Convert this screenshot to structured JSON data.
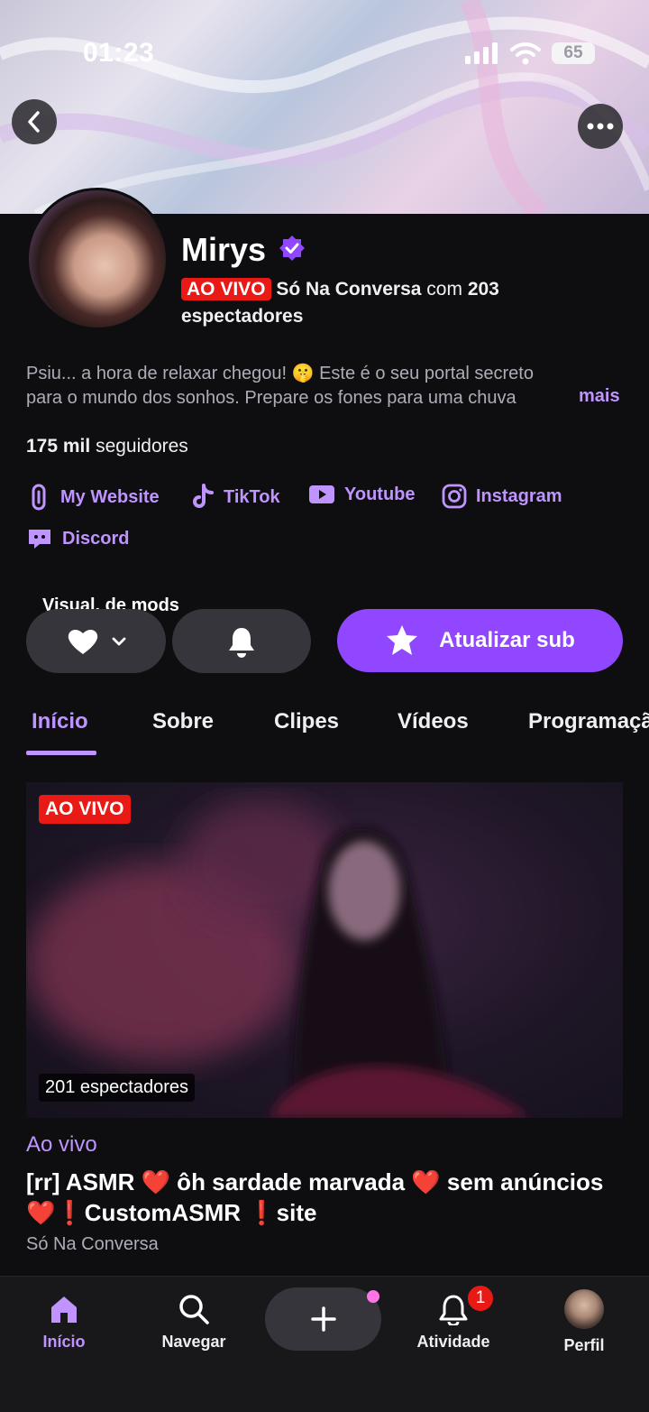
{
  "status_bar": {
    "time": "01:23",
    "battery": "65"
  },
  "channel": {
    "name": "Mirys",
    "live_badge": "AO VIVO",
    "live_category": "Só Na Conversa",
    "live_with": "com",
    "viewer_count": "203",
    "viewers_word": "espectadores",
    "bio": "Psiu... a hora de relaxar chegou! 🤫 Este é o seu portal secreto para o mundo dos sonhos. Prepare os fones para uma chuva",
    "bio_line1": "Psiu... a hora de relaxar chegou! 🤫 Este é o seu portal secreto",
    "bio_line2": "para o mundo dos sonhos. Prepare os fones para uma chuva",
    "more_label": "mais",
    "followers_count": "175 mil",
    "followers_label": "seguidores"
  },
  "social_links": [
    {
      "label": "My Website",
      "icon": "link-icon"
    },
    {
      "label": "TikTok",
      "icon": "tiktok-icon"
    },
    {
      "label": "Youtube",
      "icon": "youtube-icon"
    },
    {
      "label": "Instagram",
      "icon": "instagram-icon"
    },
    {
      "label": "Discord",
      "icon": "discord-icon"
    }
  ],
  "actions": {
    "mods_label": "Visual. de mods",
    "subscribe_label": "Atualizar sub"
  },
  "tabs": [
    {
      "label": "Início",
      "active": true
    },
    {
      "label": "Sobre"
    },
    {
      "label": "Clipes"
    },
    {
      "label": "Vídeos"
    },
    {
      "label": "Programação"
    }
  ],
  "stream": {
    "live_badge": "AO VIVO",
    "viewers": "201 espectadores",
    "status": "Ao vivo",
    "title": "[rr] ASMR ❤️ ôh sardade marvada ❤️ sem anúncios ❤️❗CustomASMR ❗site",
    "category": "Só Na Conversa"
  },
  "bottom_nav": {
    "home": "Início",
    "browse": "Navegar",
    "activity": "Atividade",
    "activity_badge": "1",
    "profile": "Perfil"
  },
  "colors": {
    "accent": "#9147ff",
    "accent_text": "#bf94ff",
    "live_red": "#e91916",
    "background": "#0e0e10"
  }
}
